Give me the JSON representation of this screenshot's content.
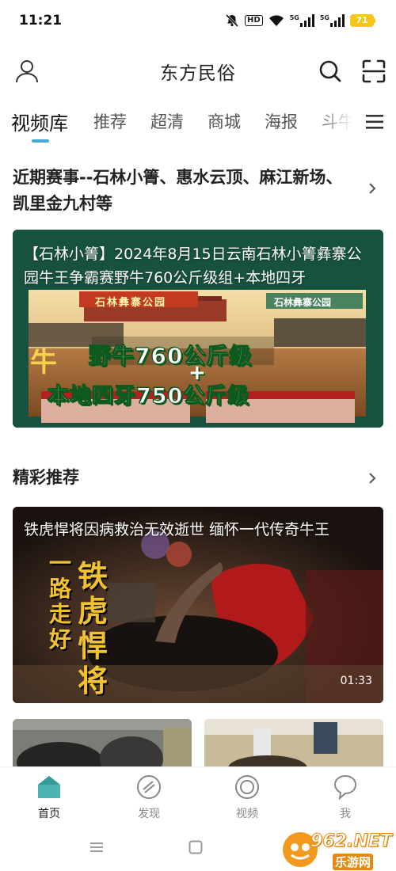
{
  "status_bar": {
    "time": "11:21",
    "hd": "HD",
    "net1": "5G",
    "net2": "5G",
    "battery": "71"
  },
  "header": {
    "title": "东方民俗",
    "icons": [
      "user-icon",
      "search-icon",
      "scan-icon"
    ]
  },
  "tabs": [
    {
      "label": "视频库",
      "active": true
    },
    {
      "label": "推荐"
    },
    {
      "label": "超清"
    },
    {
      "label": "商城"
    },
    {
      "label": "海报"
    },
    {
      "label": "斗牛"
    }
  ],
  "section1": {
    "title": "近期赛事--石林小箐、惠水云顶、麻江新场、凯里金九村等",
    "card": {
      "title": "【石林小箐】2024年8月15日云南石林小箐彝寨公园牛王争霸赛野牛760公斤级组+本地四牙",
      "poster_sign_left": "石林彝寨公园",
      "poster_sign_right": "石林彝寨公园",
      "poster_line1": "野牛760公斤级",
      "poster_plus": "+",
      "poster_line2": "本地四牙750公斤级",
      "poster_left_char": "牛"
    }
  },
  "section2": {
    "title": "精彩推荐",
    "card": {
      "title": "铁虎悍将因病救治无效逝世 缅怀一代传奇牛王",
      "calligraphy_left": "一路走好",
      "calligraphy_right": "铁虎悍将",
      "duration": "01:33"
    }
  },
  "bottom_nav": [
    {
      "label": "首页",
      "icon": "home-icon",
      "active": true
    },
    {
      "label": "发现",
      "icon": "discover-icon"
    },
    {
      "label": "视频",
      "icon": "video-icon"
    },
    {
      "label": "我",
      "icon": "chat-icon"
    }
  ],
  "watermark": {
    "brand": "962.NET",
    "sub": "乐游网"
  },
  "colors": {
    "accent": "#45a8d5",
    "home_icon": "#4bb3b0",
    "battery": "#f5c518"
  }
}
